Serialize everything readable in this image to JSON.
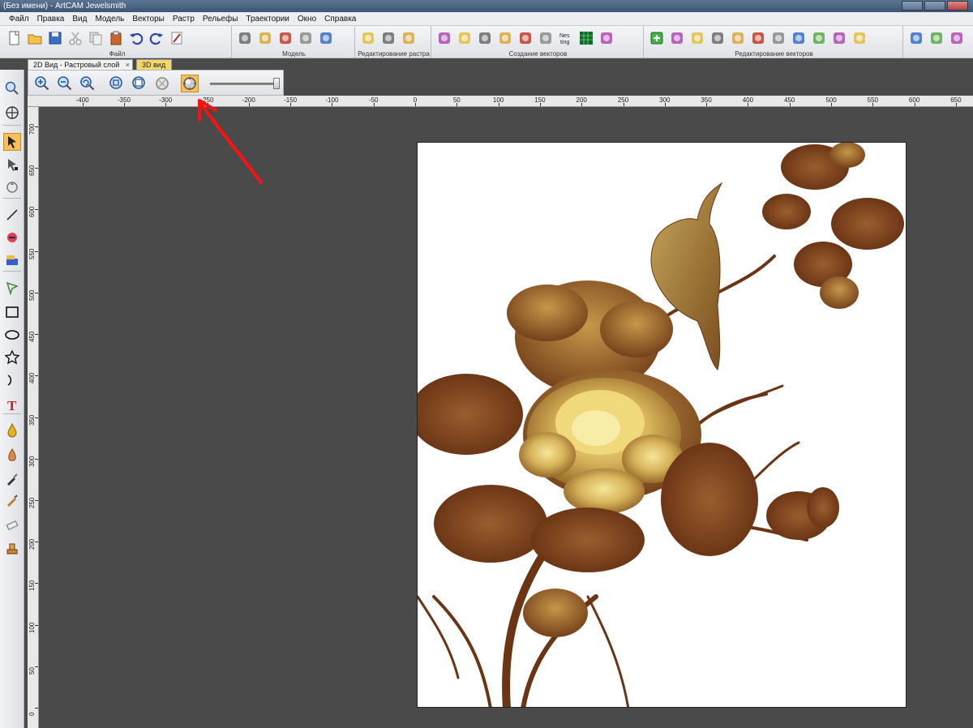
{
  "app": {
    "window_title": "(Без имени) - ArtCAM Jewelsmith"
  },
  "menu": {
    "items": [
      "Файл",
      "Правка",
      "Вид",
      "Модель",
      "Векторы",
      "Растр",
      "Рельефы",
      "Траектории",
      "Окно",
      "Справка"
    ]
  },
  "toolbar": {
    "groups": [
      {
        "label": "Файл",
        "icons": [
          "new-file-icon",
          "open-folder-icon",
          "save-disk-icon",
          "cut-icon",
          "copy-icon",
          "paste-icon",
          "undo-icon",
          "redo-icon",
          "notes-icon"
        ]
      },
      {
        "label": "Модель",
        "icons": [
          "model-red-icon",
          "model-gold-icon",
          "model-silver-icon",
          "model-red-paint-icon",
          "model-blue-sphere-icon"
        ]
      },
      {
        "label": "Редактирование растра",
        "icons": [
          "raster-edit-icon",
          "raster-diamond-icon",
          "raster-mask-icon"
        ]
      },
      {
        "label": "Создание векторов",
        "icons": [
          "vector-star-icon",
          "vector-moon-icon",
          "vector-cross-icon",
          "vector-pen-icon",
          "vector-yellow-icon",
          "vector-layers-icon",
          "nesting-icon",
          "grid-icon",
          "stack-icon"
        ]
      },
      {
        "label": "Редактирование векторов",
        "icons": [
          "add-node-icon",
          "ring-icon",
          "mirror-icon",
          "wave-icon",
          "align-icon",
          "triangle-icon",
          "group-icon",
          "shape-icon",
          "bend-icon",
          "offset-icon",
          "crop-icon"
        ]
      },
      {
        "label": "",
        "icons": [
          "blue-diamond-icon",
          "gold-arrows-icon",
          "chain-icon"
        ]
      }
    ],
    "nesting_text": "Nes ting"
  },
  "tabs": {
    "active_label": "2D Вид - Растровый слой",
    "inactive_label": "3D вид",
    "close_glyph": "×"
  },
  "view_toolbar": {
    "icons": [
      "zoom-in-icon",
      "zoom-out-icon",
      "zoom-previous-icon",
      "zoom-fit-icon",
      "zoom-box-icon",
      "zoom-all-icon",
      "shade-relief-icon"
    ],
    "shading_level": 1.0
  },
  "ruler": {
    "h_labels": [
      "-400",
      "-350",
      "-300",
      "-250",
      "-200",
      "-150",
      "-100",
      "-50",
      "0",
      "50",
      "100",
      "150",
      "200",
      "250",
      "300",
      "350",
      "400",
      "450",
      "500",
      "550",
      "600",
      "650"
    ],
    "v_labels": [
      "700",
      "650",
      "600",
      "550",
      "500",
      "450",
      "400",
      "350",
      "300",
      "250",
      "200",
      "150",
      "100",
      "50",
      "0"
    ]
  },
  "left_tools": [
    "zoom-icon",
    "globe-icon",
    "select-arrow-icon",
    "node-edit-icon",
    "transform-icon",
    "line-icon",
    "paint-icon",
    "fill-icon",
    "vector-node-icon",
    "rectangle-icon",
    "ellipse-icon",
    "star-icon",
    "arc-icon",
    "text-icon",
    "droplet-icon",
    "spray-icon",
    "brush-icon",
    "eyedropper-icon",
    "eraser-icon",
    "stamp-icon"
  ],
  "colors": {
    "canvas_bg": "#4a4a4a",
    "highlight": "#f6c15a",
    "annotation_arrow": "#ff1010",
    "relief_dark": "#5a2a0e",
    "relief_light": "#f2e08a"
  }
}
